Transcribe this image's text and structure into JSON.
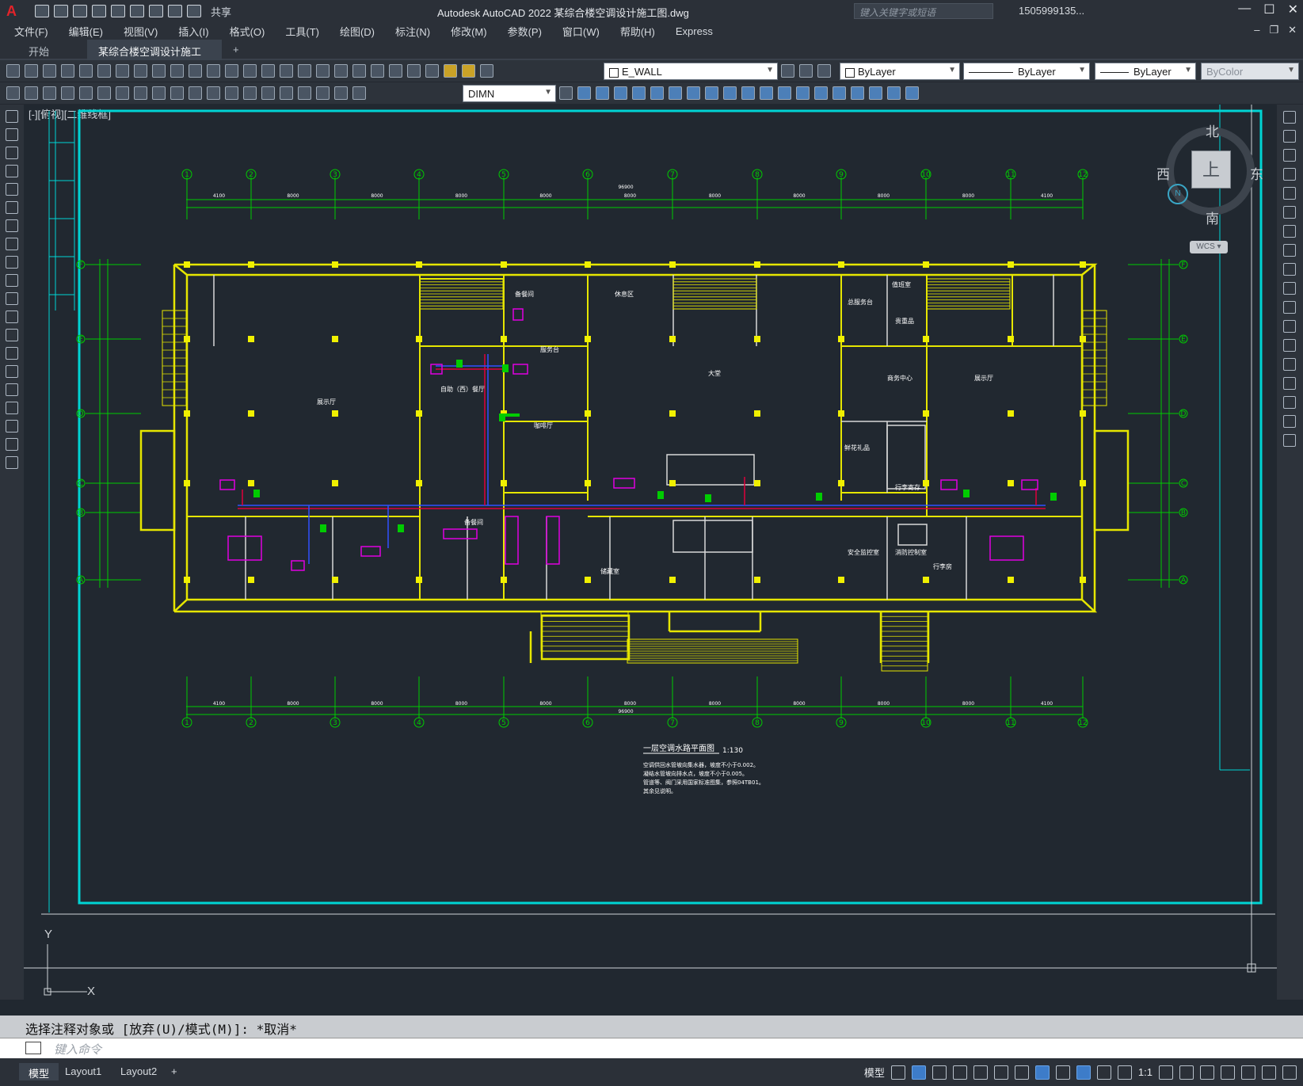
{
  "app": {
    "logo": "A",
    "title": "Autodesk AutoCAD 2022    某综合楼空调设计施工图.dwg",
    "search_placeholder": "键入关键字或短语",
    "user": "1505999135...",
    "share_label": "共享"
  },
  "menu": [
    "文件(F)",
    "编辑(E)",
    "视图(V)",
    "插入(I)",
    "格式(O)",
    "工具(T)",
    "绘图(D)",
    "标注(N)",
    "修改(M)",
    "参数(P)",
    "窗口(W)",
    "帮助(H)",
    "Express"
  ],
  "filetabs": {
    "start": "开始",
    "active": "某综合楼空调设计施工图*",
    "close": "✕",
    "plus": "+"
  },
  "toolbar": {
    "layer_combo": "E_WALL",
    "color_combo": "ByLayer",
    "linetype_combo": "ByLayer",
    "lineweight_combo": "ByLayer",
    "plotstyle_combo": "ByColor",
    "dimstyle_combo": "DIMN"
  },
  "drawing": {
    "view_label": "[-][俯视][二维线框]",
    "axis_y": "Y",
    "axis_x": "X",
    "grid_top": [
      "1",
      "2",
      "3",
      "4",
      "5",
      "6",
      "7",
      "8",
      "9",
      "10",
      "11",
      "12"
    ],
    "grid_side": [
      "F",
      "E",
      "D",
      "C",
      "B",
      "A"
    ],
    "rooms": {
      "hall": "大堂",
      "exhibit_left": "展示厅",
      "exhibit_right": "展示厅",
      "restaurant": "自助（西）餐厅",
      "cafe": "咖啡厅",
      "bar": "服务台",
      "lounge": "休息区",
      "business": "商务中心",
      "office": "总服务台",
      "storage": "贵重品",
      "flower": "鲜花礼品",
      "duty": "值班室",
      "fire": "消防控制室",
      "security": "安全监控室",
      "luggage": "行李房",
      "prep": "备餐间",
      "store": "储藏室",
      "kitchen": "备餐间",
      "west_room": "行李寄存"
    },
    "legend_title": "一层空调水路平面图",
    "legend_scale": "1:130",
    "notes": [
      "空调供回水管坡向集水器，坡度不小于0.002。",
      "凝结水管坡向排水点，坡度不小于0.005。",
      "管道等、阀门采用国家标准图集，参照04TB01。",
      "其余见说明。"
    ],
    "dim_total": "96900",
    "dim_spans": [
      "4100",
      "8000",
      "8000",
      "8000",
      "8000",
      "8000",
      "8000",
      "8000",
      "8000",
      "8000",
      "4100"
    ]
  },
  "viewcube": {
    "north": "北",
    "south": "南",
    "east": "东",
    "west": "西",
    "face": "上",
    "wcs": "WCS ▾",
    "compass": "N"
  },
  "command": {
    "history": "选择注释对象或 [放弃(U)/模式(M)]: *取消*",
    "placeholder": "键入命令"
  },
  "status": {
    "layouts": [
      "模型",
      "Layout1",
      "Layout2"
    ],
    "plus": "+",
    "model_label": "模型",
    "scale": "1:1"
  },
  "colors": {
    "wall_yellow": "#e6e600",
    "grid_green": "#00cc00",
    "cyan_border": "#00d4d4",
    "pipe_red": "#e0003a",
    "pipe_blue": "#3050ff",
    "pipe_magenta": "#e000e0",
    "text_white": "#ffffff"
  }
}
